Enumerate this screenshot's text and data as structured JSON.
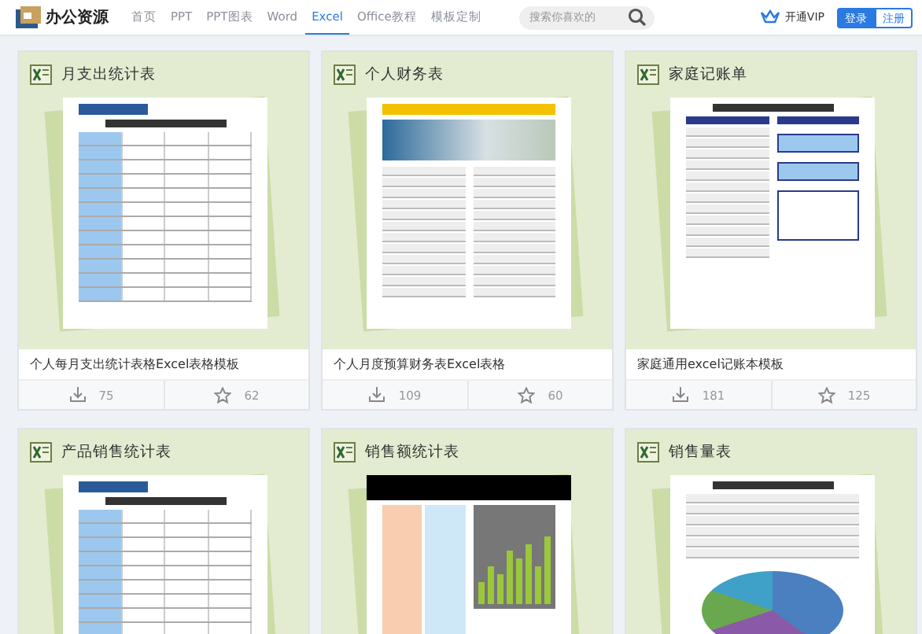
{
  "brand": {
    "name": "办公资源"
  },
  "nav": [
    {
      "label": "首页",
      "selected": false
    },
    {
      "label": "PPT",
      "selected": false
    },
    {
      "label": "PPT图表",
      "selected": false
    },
    {
      "label": "Word",
      "selected": false
    },
    {
      "label": "Excel",
      "selected": true
    },
    {
      "label": "Office教程",
      "selected": false
    },
    {
      "label": "模板定制",
      "selected": false
    }
  ],
  "search": {
    "placeholder": "搜索你喜欢的"
  },
  "vip": "开通VIP",
  "login": "登录",
  "register": "注册",
  "cards": [
    {
      "title": "月支出统计表",
      "kind": "table",
      "caption": "个人每月支出统计表格Excel表格模板",
      "downloads": "75",
      "favorites": "62"
    },
    {
      "title": "个人财务表",
      "kind": "report",
      "caption": "个人月度预算财务表Excel表格",
      "downloads": "109",
      "favorites": "60"
    },
    {
      "title": "家庭记账单",
      "kind": "ledger",
      "caption": "家庭通用excel记账本模板",
      "downloads": "181",
      "favorites": "125"
    },
    {
      "title": "产品销售统计表",
      "kind": "table"
    },
    {
      "title": "销售额统计表",
      "kind": "chart"
    },
    {
      "title": "销售量表",
      "kind": "pie"
    }
  ]
}
